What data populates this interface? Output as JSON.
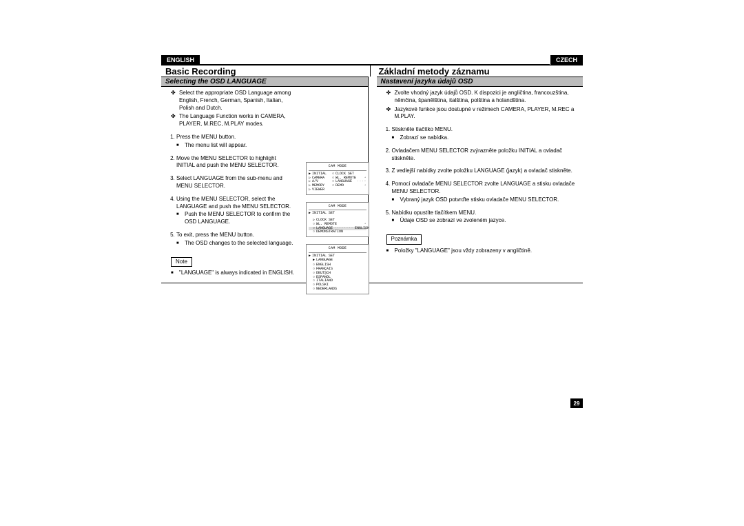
{
  "page_number": "29",
  "left": {
    "lang_pill": "ENGLISH",
    "title": "Basic Recording",
    "subtitle": "Selecting the OSD LANGUAGE",
    "intro": [
      "Select the appropriate OSD Language among English, French, German, Spanish, Italian, Polish and Dutch.",
      "The Language Function works in CAMERA, PLAYER, M.REC, M.PLAY modes."
    ],
    "steps": [
      {
        "text": "Press the MENU button.",
        "sub": [
          "The menu list will appear."
        ]
      },
      {
        "text": "Move the MENU SELECTOR to highlight INITIAL and push the MENU SELECTOR.",
        "sub": []
      },
      {
        "text": "Select LANGUAGE from the sub-menu and MENU SELECTOR.",
        "sub": []
      },
      {
        "text": "Using the MENU SELECTOR, select the LANGUAGE and push the MENU SELECTOR.",
        "sub": [
          "Push the MENU SELECTOR to confirm the OSD LANGUAGE."
        ]
      },
      {
        "text": "To exit, press the MENU button.",
        "sub": [
          "The OSD changes to the selected language."
        ]
      }
    ],
    "note_label": "Note",
    "note_text": "\"LANGUAGE\" is always indicated in ENGLISH."
  },
  "right": {
    "lang_pill": "CZECH",
    "title": "Základní metody záznamu",
    "subtitle": "Nastavení jazyka údajů OSD",
    "intro": [
      "Zvolte vhodný jazyk údajů OSD. K dispozici je angličtina, francouzština, němčina, španělština, italština, polština a holandština.",
      "Jazykové funkce jsou dostupné v režimech CAMERA, PLAYER, M.REC a M.PLAY."
    ],
    "steps": [
      {
        "text": "Stiskněte tlačítko MENU.",
        "sub": [
          "Zobrazí se nabídka."
        ]
      },
      {
        "text": "Ovladačem MENU SELECTOR zvýrazněte položku INITIAL a ovladač stiskněte.",
        "sub": []
      },
      {
        "text": "Z vedlejší nabídky zvolte položku LANGUAGE (jazyk) a ovladač stiskněte.",
        "sub": []
      },
      {
        "text": "Pomocí ovladače MENU SELECTOR zvolte LANGUAGE a stisku ovladače MENU SELECTOR.",
        "sub": [
          "Vybraný jazyk OSD potvrďte stisku ovladače MENU SELECTOR."
        ]
      },
      {
        "text": "Nabídku opustíte tlačítkem MENU.",
        "sub": [
          "Údaje OSD se zobrazí ve zvoleném jazyce."
        ]
      }
    ],
    "note_label": "Poznámka",
    "note_text": "Položky \"LANGUAGE\" jsou vždy zobrazeny v angličtině."
  },
  "osd": {
    "title": "CAM MODE",
    "screen1": [
      {
        "l": "INITIAL",
        "r": "CLOCK SET",
        "tri": true
      },
      {
        "l": "CAMERA",
        "r": "WL. REMOTE",
        "mark": true
      },
      {
        "l": "A/V",
        "r": "LANGUAGE",
        "dots": true
      },
      {
        "l": "MEMORY",
        "r": "DEMO",
        "mark": true
      },
      {
        "l": "VIEWER",
        "r": ""
      }
    ],
    "screen2_header": "INITIAL SET",
    "screen2": [
      {
        "label": "CLOCK SET"
      },
      {
        "label": "WL. REMOTE",
        "mark": true
      },
      {
        "label": "LANGUAGE",
        "sel": true,
        "value": "ENGLISH"
      },
      {
        "label": "DEMONSTRATION"
      }
    ],
    "screen3_headers": [
      "INITIAL SET",
      "LANGUAGE"
    ],
    "screen3_langs": [
      "ENGLISH",
      "FRANÇAIS",
      "DEUTSCH",
      "ESPAÑOL",
      "ITALIANO",
      "POLSKI",
      "NEDERLANDS"
    ]
  }
}
